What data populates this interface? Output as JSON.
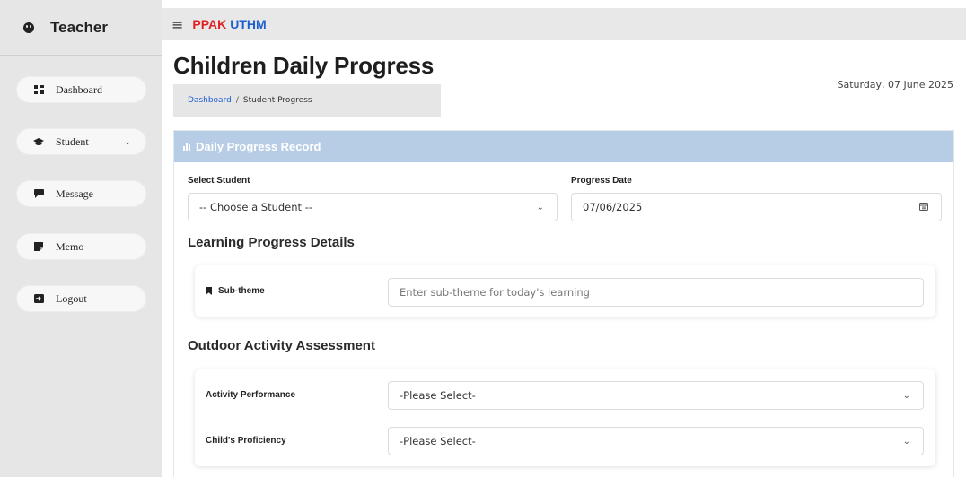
{
  "sidebar": {
    "title": "Teacher",
    "items": [
      {
        "label": "Dashboard"
      },
      {
        "label": "Student"
      },
      {
        "label": "Message"
      },
      {
        "label": "Memo"
      },
      {
        "label": "Logout"
      }
    ]
  },
  "topbar": {
    "brand_part1": "PPAK",
    "brand_part2": "UTHM"
  },
  "page": {
    "title": "Children Daily Progress",
    "date": "Saturday, 07 June 2025",
    "breadcrumb": {
      "link": "Dashboard",
      "separator": "/",
      "current": "Student Progress"
    }
  },
  "card": {
    "header": "Daily Progress Record",
    "select_student_label": "Select Student",
    "select_student_value": "-- Choose a Student --",
    "progress_date_label": "Progress Date",
    "progress_date_value": "07/06/2025",
    "learning_section": "Learning Progress Details",
    "subtheme_label": "Sub-theme",
    "subtheme_placeholder": "Enter sub-theme for today's learning",
    "outdoor_section": "Outdoor Activity Assessment",
    "activity_label": "Activity Performance",
    "activity_value": "-Please Select-",
    "proficiency_label": "Child's Proficiency",
    "proficiency_value": "-Please Select-"
  },
  "colors": {
    "card_header": "#b7cde6",
    "brand_red": "#e02020",
    "brand_blue": "#1f5fd0",
    "sidebar_bg": "#e6e6e6"
  },
  "icons": {
    "sidebar_header": "smiley-icon",
    "dashboard": "dashboard-grid-icon",
    "student": "graduation-cap-icon",
    "message": "message-icon",
    "memo": "sticky-note-icon",
    "logout": "logout-icon",
    "topbar_menu": "hamburger-menu-icon",
    "card_header": "bar-chart-icon",
    "subtheme": "bookmark-icon",
    "dropdown": "chevron-down-icon",
    "date": "calendar-icon"
  }
}
